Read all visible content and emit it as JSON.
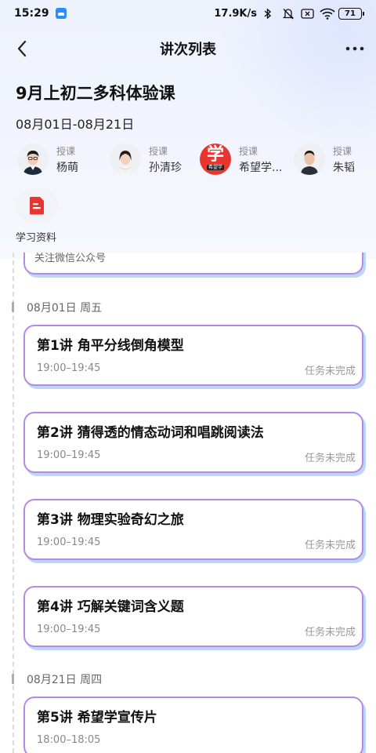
{
  "status_bar": {
    "time": "15:29",
    "network_speed": "17.9K/s",
    "battery": "71",
    "icons": [
      "app-icon",
      "bluetooth-icon",
      "mute-icon",
      "sim-icon",
      "wifi-icon",
      "battery-icon"
    ]
  },
  "nav": {
    "title": "讲次列表",
    "back_icon": "chevron-left-icon",
    "more_icon": "more-dots-icon"
  },
  "course": {
    "title": "9月上初二多科体验课",
    "date_range": "08月01日-08月21日"
  },
  "teachers": [
    {
      "role": "授课",
      "name": "杨萌"
    },
    {
      "role": "授课",
      "name": "孙清珍"
    },
    {
      "role": "授课",
      "name": "希望学..."
    },
    {
      "role": "授课",
      "name": "朱韬"
    }
  ],
  "logo_text": "学",
  "logo_sub": "希望学",
  "materials": {
    "label": "学习资料",
    "icon": "document-icon"
  },
  "list": {
    "wechat_card_text": "关注微信公众号",
    "groups": [
      {
        "date": "08月01日 周五",
        "lessons": [
          {
            "title": "第1讲 角平分线倒角模型",
            "time": "19:00–19:45",
            "status": "任务未完成"
          },
          {
            "title": "第2讲 猜得透的情态动词和唱跳阅读法",
            "time": "19:00–19:45",
            "status": "任务未完成"
          },
          {
            "title": "第3讲 物理实验奇幻之旅",
            "time": "19:00–19:45",
            "status": "任务未完成"
          },
          {
            "title": "第4讲 巧解关键词含义题",
            "time": "19:00–19:45",
            "status": "任务未完成"
          }
        ]
      },
      {
        "date": "08月21日 周四",
        "lessons": [
          {
            "title": "第5讲 希望学宣传片",
            "time": "18:00–18:05",
            "status": ""
          }
        ]
      }
    ]
  },
  "colors": {
    "card_border": "#b38ae6",
    "card_shadow": "#bdd6f7",
    "logo_red": "#e8352f",
    "material_icon_red": "#e8352f"
  }
}
